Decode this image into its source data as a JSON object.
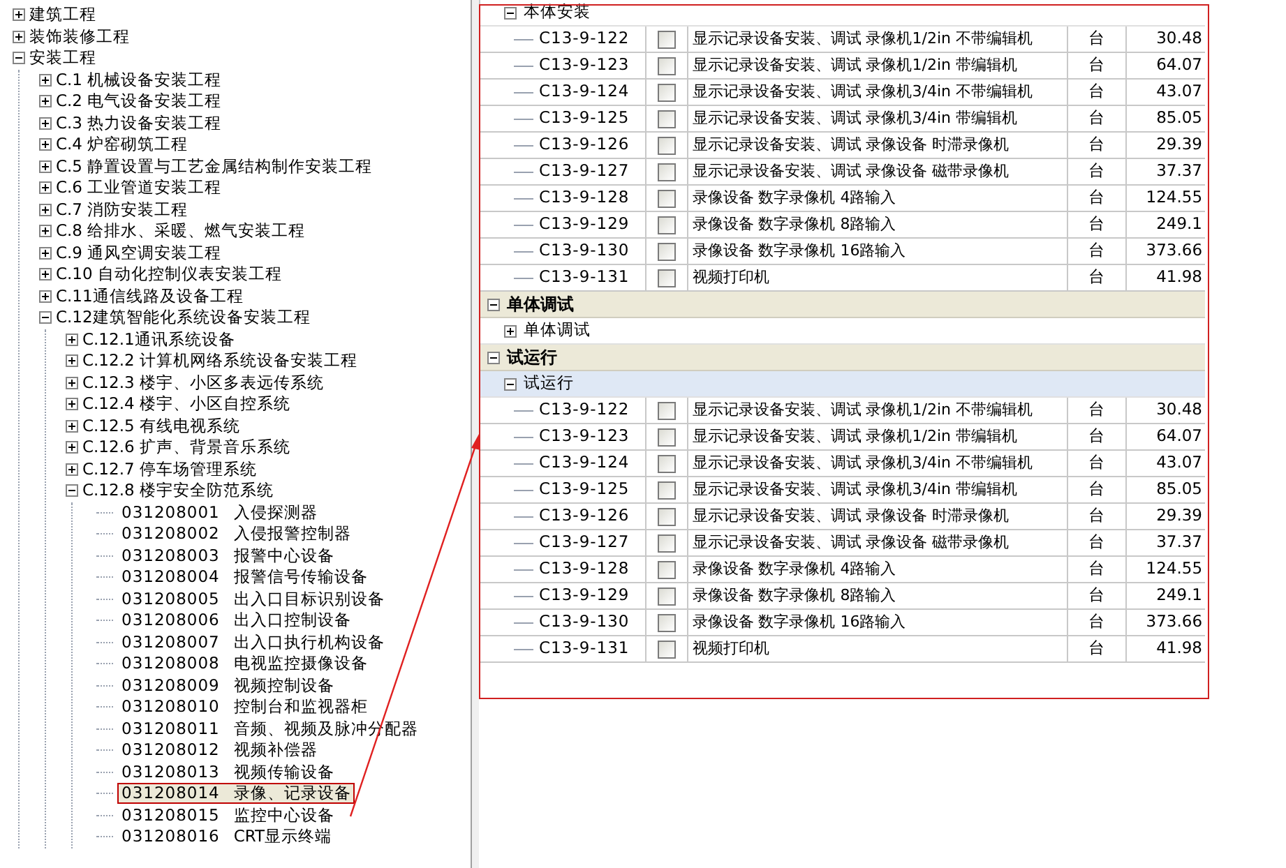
{
  "tree": [
    {
      "label": "建筑工程",
      "expanded": false
    },
    {
      "label": "装饰装修工程",
      "expanded": false
    },
    {
      "label": "安装工程",
      "expanded": true,
      "children": [
        {
          "label": "C.1 机械设备安装工程",
          "expanded": false
        },
        {
          "label": "C.2 电气设备安装工程",
          "expanded": false
        },
        {
          "label": "C.3 热力设备安装工程",
          "expanded": false
        },
        {
          "label": "C.4 炉窑砌筑工程",
          "expanded": false
        },
        {
          "label": "C.5 静置设置与工艺金属结构制作安装工程",
          "expanded": false
        },
        {
          "label": "C.6 工业管道安装工程",
          "expanded": false
        },
        {
          "label": "C.7 消防安装工程",
          "expanded": false
        },
        {
          "label": "C.8 给排水、采暖、燃气安装工程",
          "expanded": false
        },
        {
          "label": "C.9 通风空调安装工程",
          "expanded": false
        },
        {
          "label": "C.10 自动化控制仪表安装工程",
          "expanded": false
        },
        {
          "label": "C.11通信线路及设备工程",
          "expanded": false
        },
        {
          "label": "C.12建筑智能化系统设备安装工程",
          "expanded": true,
          "children": [
            {
              "label": "C.12.1通讯系统设备",
              "expanded": false
            },
            {
              "label": "C.12.2 计算机网络系统设备安装工程",
              "expanded": false
            },
            {
              "label": "C.12.3 楼宇、小区多表远传系统",
              "expanded": false
            },
            {
              "label": "C.12.4 楼宇、小区自控系统",
              "expanded": false
            },
            {
              "label": "C.12.5 有线电视系统",
              "expanded": false
            },
            {
              "label": "C.12.6 扩声、背景音乐系统",
              "expanded": false
            },
            {
              "label": "C.12.7 停车场管理系统",
              "expanded": false
            },
            {
              "label": "C.12.8 楼宇安全防范系统",
              "expanded": true,
              "children": [
                {
                  "code": "031208001",
                  "label": "入侵探测器",
                  "selected": false
                },
                {
                  "code": "031208002",
                  "label": "入侵报警控制器",
                  "selected": false
                },
                {
                  "code": "031208003",
                  "label": "报警中心设备",
                  "selected": false
                },
                {
                  "code": "031208004",
                  "label": "报警信号传输设备",
                  "selected": false
                },
                {
                  "code": "031208005",
                  "label": "出入口目标识别设备",
                  "selected": false
                },
                {
                  "code": "031208006",
                  "label": "出入口控制设备",
                  "selected": false
                },
                {
                  "code": "031208007",
                  "label": "出入口执行机构设备",
                  "selected": false
                },
                {
                  "code": "031208008",
                  "label": "电视监控摄像设备",
                  "selected": false
                },
                {
                  "code": "031208009",
                  "label": "视频控制设备",
                  "selected": false
                },
                {
                  "code": "031208010",
                  "label": "控制台和监视器柜",
                  "selected": false
                },
                {
                  "code": "031208011",
                  "label": "音频、视频及脉冲分配器",
                  "selected": false
                },
                {
                  "code": "031208012",
                  "label": "视频补偿器",
                  "selected": false
                },
                {
                  "code": "031208013",
                  "label": "视频传输设备",
                  "selected": false
                },
                {
                  "code": "031208014",
                  "label": "录像、记录设备",
                  "selected": true
                },
                {
                  "code": "031208015",
                  "label": "监控中心设备",
                  "selected": false
                },
                {
                  "code": "031208016",
                  "label": "CRT显示终端",
                  "selected": false
                }
              ]
            }
          ]
        }
      ]
    }
  ],
  "grid": [
    {
      "kind": "subgroup",
      "label": "本体安装",
      "expanded": true,
      "selected": false
    },
    {
      "kind": "item",
      "code": "C13-9-122",
      "checked": false,
      "name": "显示记录设备安装、调试 录像机1/2in 不带编辑机",
      "unit": "台",
      "price": "30.48"
    },
    {
      "kind": "item",
      "code": "C13-9-123",
      "checked": false,
      "name": "显示记录设备安装、调试 录像机1/2in 带编辑机",
      "unit": "台",
      "price": "64.07"
    },
    {
      "kind": "item",
      "code": "C13-9-124",
      "checked": false,
      "name": "显示记录设备安装、调试 录像机3/4in 不带编辑机",
      "unit": "台",
      "price": "43.07"
    },
    {
      "kind": "item",
      "code": "C13-9-125",
      "checked": false,
      "name": "显示记录设备安装、调试 录像机3/4in 带编辑机",
      "unit": "台",
      "price": "85.05"
    },
    {
      "kind": "item",
      "code": "C13-9-126",
      "checked": false,
      "name": "显示记录设备安装、调试 录像设备 时滞录像机",
      "unit": "台",
      "price": "29.39"
    },
    {
      "kind": "item",
      "code": "C13-9-127",
      "checked": false,
      "name": "显示记录设备安装、调试 录像设备 磁带录像机",
      "unit": "台",
      "price": "37.37"
    },
    {
      "kind": "item",
      "code": "C13-9-128",
      "checked": false,
      "name": "录像设备 数字录像机 4路输入",
      "unit": "台",
      "price": "124.55"
    },
    {
      "kind": "item",
      "code": "C13-9-129",
      "checked": false,
      "name": "录像设备 数字录像机 8路输入",
      "unit": "台",
      "price": "249.1"
    },
    {
      "kind": "item",
      "code": "C13-9-130",
      "checked": false,
      "name": "录像设备 数字录像机 16路输入",
      "unit": "台",
      "price": "373.66"
    },
    {
      "kind": "item",
      "code": "C13-9-131",
      "checked": false,
      "name": "视频打印机",
      "unit": "台",
      "price": "41.98"
    },
    {
      "kind": "group",
      "label": "单体调试",
      "expanded": true
    },
    {
      "kind": "subgroup",
      "label": "单体调试",
      "expanded": false,
      "selected": false
    },
    {
      "kind": "group",
      "label": "试运行",
      "expanded": true
    },
    {
      "kind": "subgroup",
      "label": "试运行",
      "expanded": true,
      "selected": true
    },
    {
      "kind": "item",
      "code": "C13-9-122",
      "checked": false,
      "name": "显示记录设备安装、调试 录像机1/2in 不带编辑机",
      "unit": "台",
      "price": "30.48"
    },
    {
      "kind": "item",
      "code": "C13-9-123",
      "checked": false,
      "name": "显示记录设备安装、调试 录像机1/2in 带编辑机",
      "unit": "台",
      "price": "64.07"
    },
    {
      "kind": "item",
      "code": "C13-9-124",
      "checked": false,
      "name": "显示记录设备安装、调试 录像机3/4in 不带编辑机",
      "unit": "台",
      "price": "43.07"
    },
    {
      "kind": "item",
      "code": "C13-9-125",
      "checked": false,
      "name": "显示记录设备安装、调试 录像机3/4in 带编辑机",
      "unit": "台",
      "price": "85.05"
    },
    {
      "kind": "item",
      "code": "C13-9-126",
      "checked": false,
      "name": "显示记录设备安装、调试 录像设备 时滞录像机",
      "unit": "台",
      "price": "29.39"
    },
    {
      "kind": "item",
      "code": "C13-9-127",
      "checked": false,
      "name": "显示记录设备安装、调试 录像设备 磁带录像机",
      "unit": "台",
      "price": "37.37"
    },
    {
      "kind": "item",
      "code": "C13-9-128",
      "checked": false,
      "name": "录像设备 数字录像机 4路输入",
      "unit": "台",
      "price": "124.55"
    },
    {
      "kind": "item",
      "code": "C13-9-129",
      "checked": false,
      "name": "录像设备 数字录像机 8路输入",
      "unit": "台",
      "price": "249.1"
    },
    {
      "kind": "item",
      "code": "C13-9-130",
      "checked": false,
      "name": "录像设备 数字录像机 16路输入",
      "unit": "台",
      "price": "373.66"
    },
    {
      "kind": "item",
      "code": "C13-9-131",
      "checked": false,
      "name": "视频打印机",
      "unit": "台",
      "price": "41.98"
    }
  ]
}
